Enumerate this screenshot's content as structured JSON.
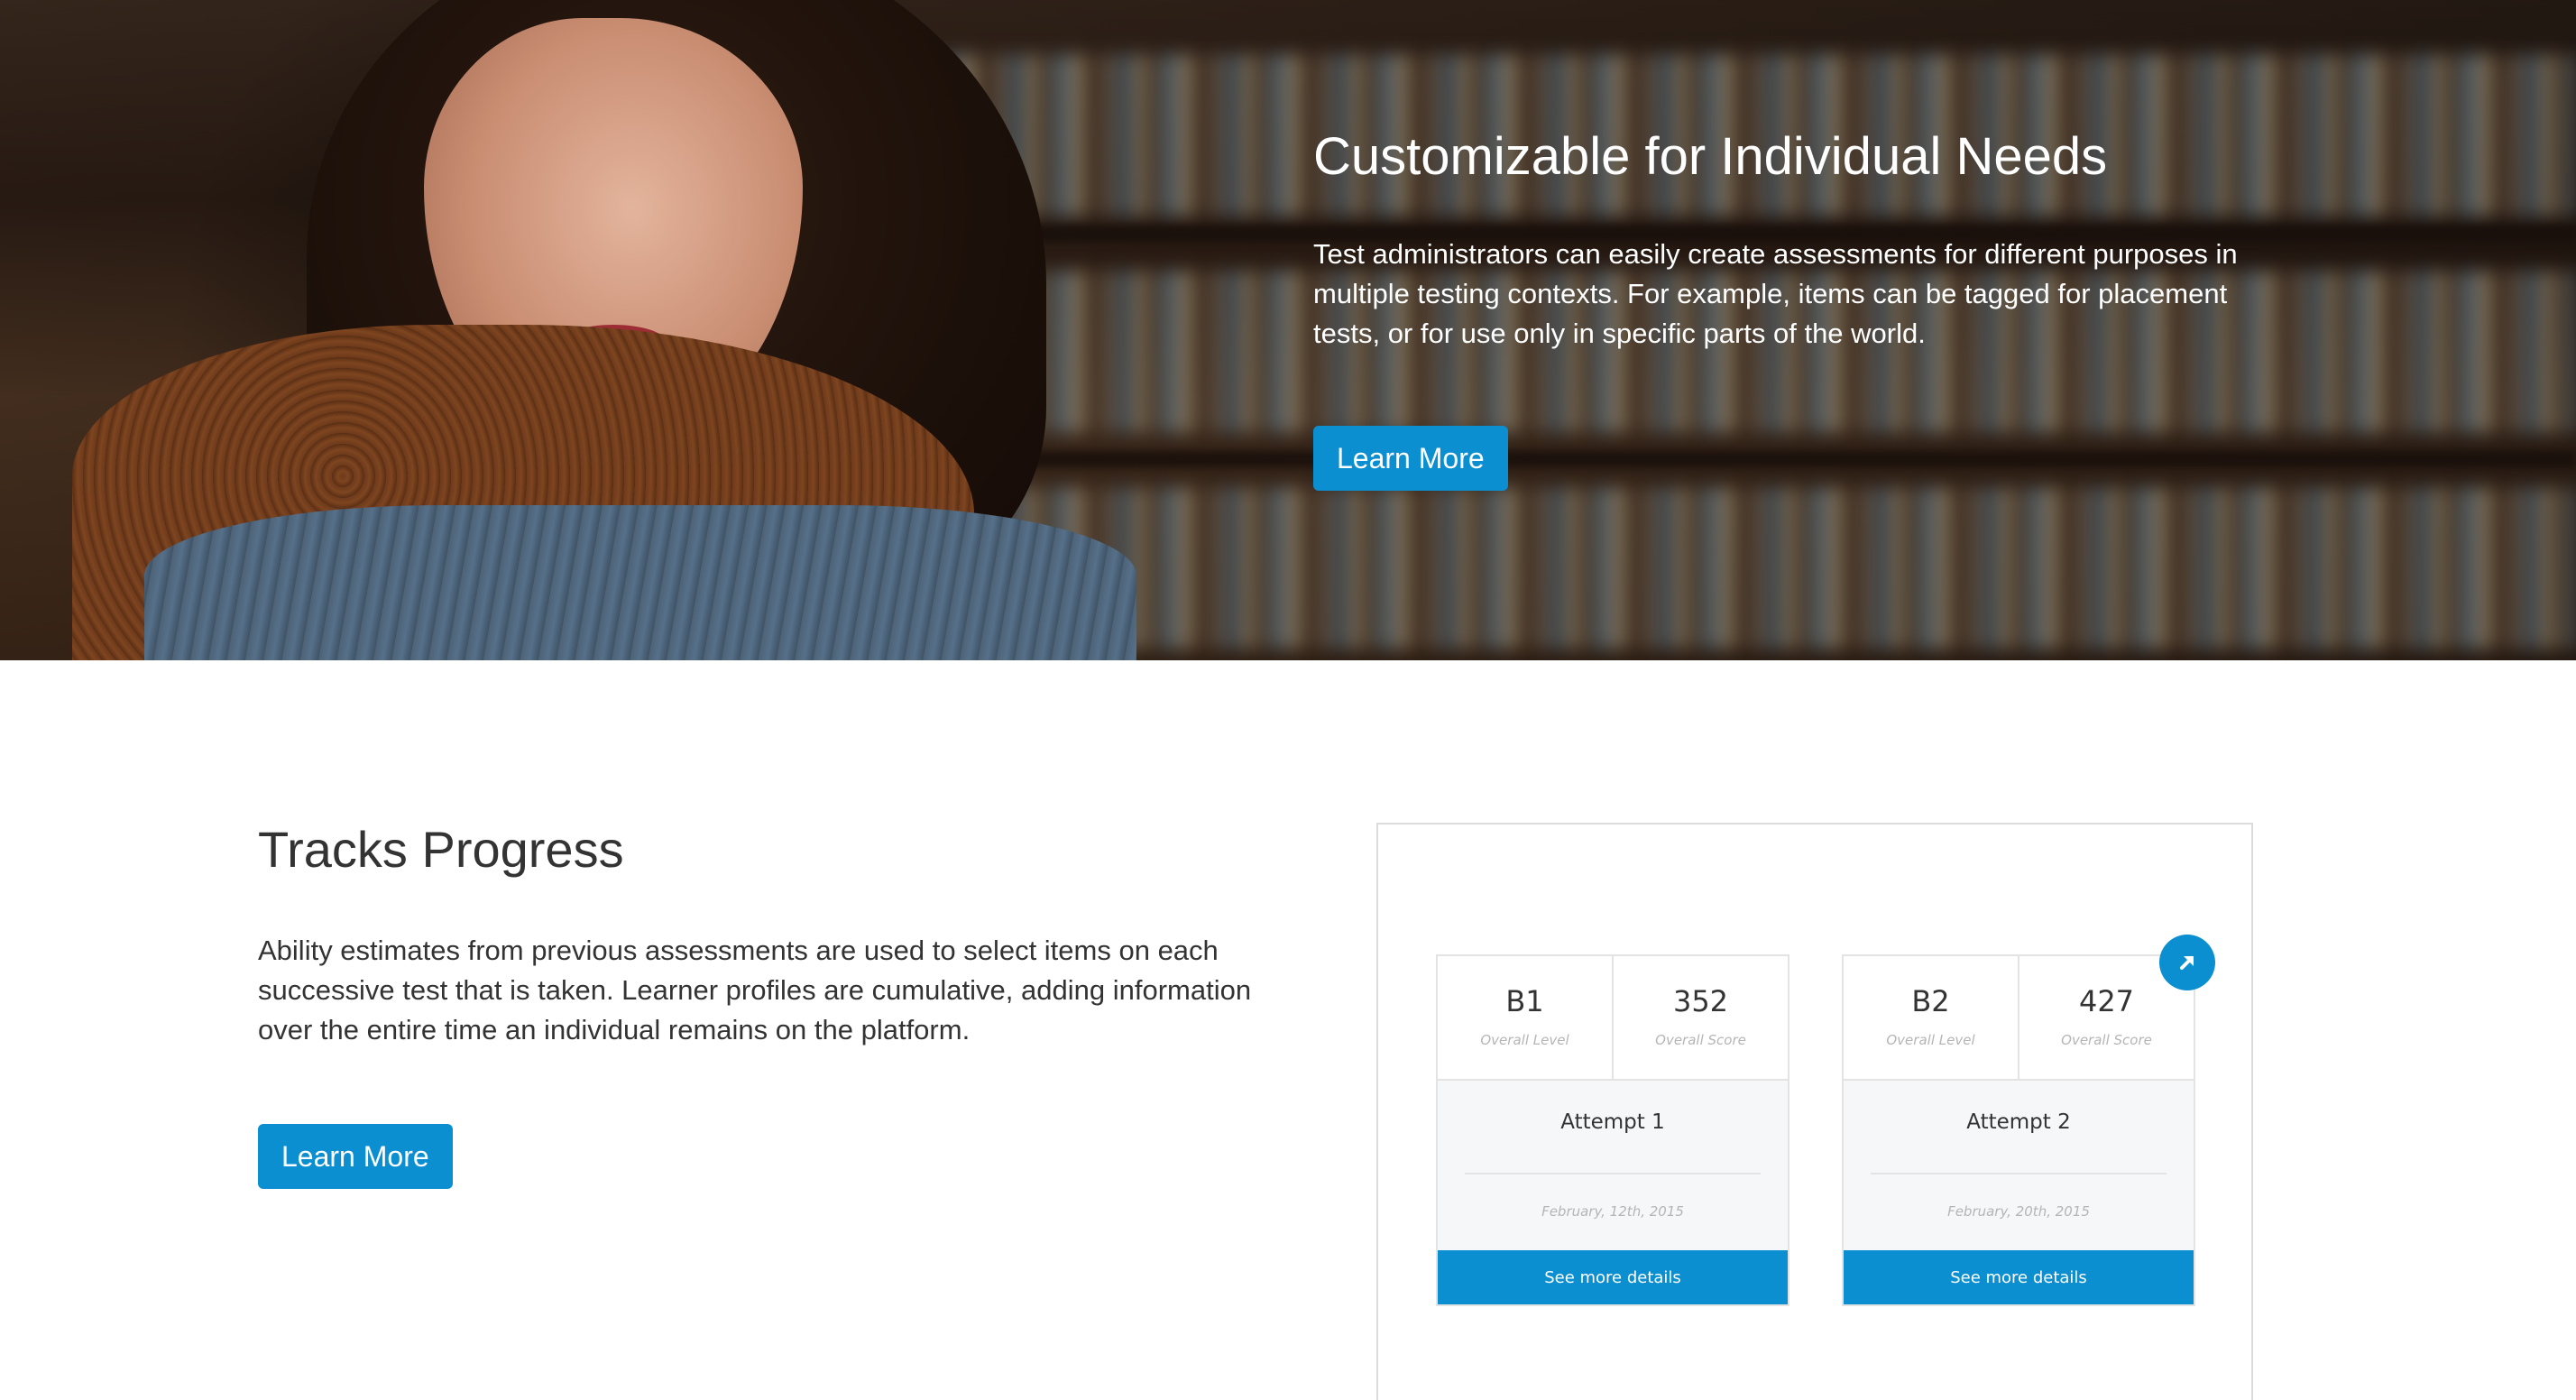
{
  "hero": {
    "title": "Customizable for Individual Needs",
    "text": "Test administrators can easily create assessments for different purposes in multiple testing contexts. For example, items can be tagged for placement tests, or for use only in specific parts of the world.",
    "button_label": "Learn More"
  },
  "progress": {
    "title": "Tracks Progress",
    "text": "Ability estimates from previous assessments are used to select items on each successive test that is taken. Learner profiles are cumulative, adding information over the entire time an individual remains on the platform.",
    "button_label": "Learn More",
    "expand_icon": "arrow-up-right-icon",
    "cards": [
      {
        "level": "B1",
        "level_label": "Overall Level",
        "score": "352",
        "score_label": "Overall Score",
        "attempt": "Attempt 1",
        "date": "February, 12th, 2015",
        "button_label": "See more details"
      },
      {
        "level": "B2",
        "level_label": "Overall Level",
        "score": "427",
        "score_label": "Overall Score",
        "attempt": "Attempt 2",
        "date": "February, 20th, 2015",
        "button_label": "See more details"
      }
    ]
  },
  "colors": {
    "accent": "#0b8fd1",
    "heading": "#333333",
    "muted": "#b5b5b5",
    "card_body": "#f5f7f9"
  }
}
